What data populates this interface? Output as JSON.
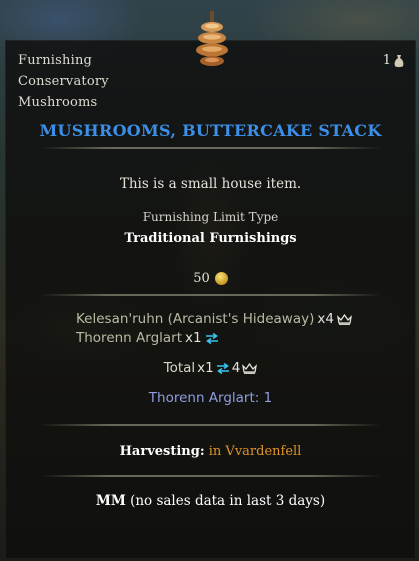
{
  "item": {
    "categories": [
      "Furnishing",
      "Conservatory",
      "Mushrooms"
    ],
    "count": "1",
    "title": "MUSHROOMS, BUTTERCAKE STACK",
    "description": "This is a small house item.",
    "limit_label": "Furnishing Limit Type",
    "limit_value": "Traditional Furnishings",
    "price": "50"
  },
  "inventory": {
    "line1_name": "Kelesan'ruhn (Arcanist's Hideaway)",
    "line1_qty": "x4",
    "line2_name": "Thorenn Arglart",
    "line2_qty": "x1",
    "total_label": "Total",
    "total_qty1": "x1",
    "total_qty2": "4",
    "char_name": "Thorenn Arglart:",
    "char_count": "1"
  },
  "harvest": {
    "label": "Harvesting:",
    "location": "in Vvardenfell"
  },
  "mm": {
    "label": "MM",
    "text": "(no sales data in last 3 days)"
  },
  "colors": {
    "title": "#3b8fe8",
    "transfer": "#36c4ef",
    "character": "#8f9ddf",
    "location": "#e0932a"
  },
  "icons": [
    "mushroom-icon",
    "bag-icon",
    "gold-coin-icon",
    "crown-icon",
    "transfer-arrows-icon"
  ]
}
